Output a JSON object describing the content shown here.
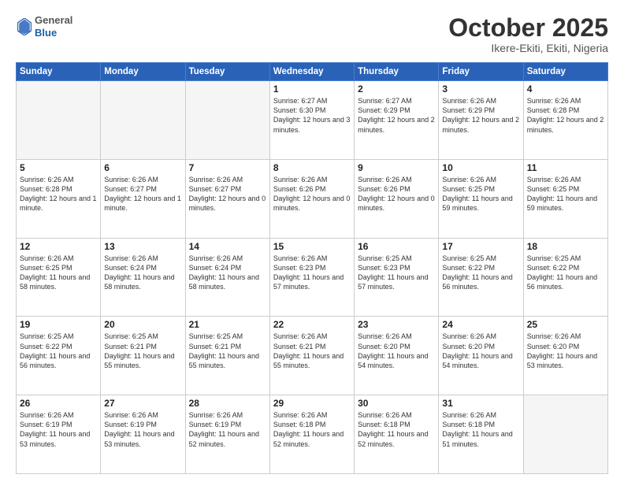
{
  "header": {
    "logo_general": "General",
    "logo_blue": "Blue",
    "month_title": "October 2025",
    "location": "Ikere-Ekiti, Ekiti, Nigeria"
  },
  "weekdays": [
    "Sunday",
    "Monday",
    "Tuesday",
    "Wednesday",
    "Thursday",
    "Friday",
    "Saturday"
  ],
  "rows": [
    [
      {
        "day": "",
        "text": ""
      },
      {
        "day": "",
        "text": ""
      },
      {
        "day": "",
        "text": ""
      },
      {
        "day": "1",
        "text": "Sunrise: 6:27 AM\nSunset: 6:30 PM\nDaylight: 12 hours and 3 minutes."
      },
      {
        "day": "2",
        "text": "Sunrise: 6:27 AM\nSunset: 6:29 PM\nDaylight: 12 hours and 2 minutes."
      },
      {
        "day": "3",
        "text": "Sunrise: 6:26 AM\nSunset: 6:29 PM\nDaylight: 12 hours and 2 minutes."
      },
      {
        "day": "4",
        "text": "Sunrise: 6:26 AM\nSunset: 6:28 PM\nDaylight: 12 hours and 2 minutes."
      }
    ],
    [
      {
        "day": "5",
        "text": "Sunrise: 6:26 AM\nSunset: 6:28 PM\nDaylight: 12 hours and 1 minute."
      },
      {
        "day": "6",
        "text": "Sunrise: 6:26 AM\nSunset: 6:27 PM\nDaylight: 12 hours and 1 minute."
      },
      {
        "day": "7",
        "text": "Sunrise: 6:26 AM\nSunset: 6:27 PM\nDaylight: 12 hours and 0 minutes."
      },
      {
        "day": "8",
        "text": "Sunrise: 6:26 AM\nSunset: 6:26 PM\nDaylight: 12 hours and 0 minutes."
      },
      {
        "day": "9",
        "text": "Sunrise: 6:26 AM\nSunset: 6:26 PM\nDaylight: 12 hours and 0 minutes."
      },
      {
        "day": "10",
        "text": "Sunrise: 6:26 AM\nSunset: 6:25 PM\nDaylight: 11 hours and 59 minutes."
      },
      {
        "day": "11",
        "text": "Sunrise: 6:26 AM\nSunset: 6:25 PM\nDaylight: 11 hours and 59 minutes."
      }
    ],
    [
      {
        "day": "12",
        "text": "Sunrise: 6:26 AM\nSunset: 6:25 PM\nDaylight: 11 hours and 58 minutes."
      },
      {
        "day": "13",
        "text": "Sunrise: 6:26 AM\nSunset: 6:24 PM\nDaylight: 11 hours and 58 minutes."
      },
      {
        "day": "14",
        "text": "Sunrise: 6:26 AM\nSunset: 6:24 PM\nDaylight: 11 hours and 58 minutes."
      },
      {
        "day": "15",
        "text": "Sunrise: 6:26 AM\nSunset: 6:23 PM\nDaylight: 11 hours and 57 minutes."
      },
      {
        "day": "16",
        "text": "Sunrise: 6:25 AM\nSunset: 6:23 PM\nDaylight: 11 hours and 57 minutes."
      },
      {
        "day": "17",
        "text": "Sunrise: 6:25 AM\nSunset: 6:22 PM\nDaylight: 11 hours and 56 minutes."
      },
      {
        "day": "18",
        "text": "Sunrise: 6:25 AM\nSunset: 6:22 PM\nDaylight: 11 hours and 56 minutes."
      }
    ],
    [
      {
        "day": "19",
        "text": "Sunrise: 6:25 AM\nSunset: 6:22 PM\nDaylight: 11 hours and 56 minutes."
      },
      {
        "day": "20",
        "text": "Sunrise: 6:25 AM\nSunset: 6:21 PM\nDaylight: 11 hours and 55 minutes."
      },
      {
        "day": "21",
        "text": "Sunrise: 6:25 AM\nSunset: 6:21 PM\nDaylight: 11 hours and 55 minutes."
      },
      {
        "day": "22",
        "text": "Sunrise: 6:26 AM\nSunset: 6:21 PM\nDaylight: 11 hours and 55 minutes."
      },
      {
        "day": "23",
        "text": "Sunrise: 6:26 AM\nSunset: 6:20 PM\nDaylight: 11 hours and 54 minutes."
      },
      {
        "day": "24",
        "text": "Sunrise: 6:26 AM\nSunset: 6:20 PM\nDaylight: 11 hours and 54 minutes."
      },
      {
        "day": "25",
        "text": "Sunrise: 6:26 AM\nSunset: 6:20 PM\nDaylight: 11 hours and 53 minutes."
      }
    ],
    [
      {
        "day": "26",
        "text": "Sunrise: 6:26 AM\nSunset: 6:19 PM\nDaylight: 11 hours and 53 minutes."
      },
      {
        "day": "27",
        "text": "Sunrise: 6:26 AM\nSunset: 6:19 PM\nDaylight: 11 hours and 53 minutes."
      },
      {
        "day": "28",
        "text": "Sunrise: 6:26 AM\nSunset: 6:19 PM\nDaylight: 11 hours and 52 minutes."
      },
      {
        "day": "29",
        "text": "Sunrise: 6:26 AM\nSunset: 6:18 PM\nDaylight: 11 hours and 52 minutes."
      },
      {
        "day": "30",
        "text": "Sunrise: 6:26 AM\nSunset: 6:18 PM\nDaylight: 11 hours and 52 minutes."
      },
      {
        "day": "31",
        "text": "Sunrise: 6:26 AM\nSunset: 6:18 PM\nDaylight: 11 hours and 51 minutes."
      },
      {
        "day": "",
        "text": ""
      }
    ]
  ]
}
